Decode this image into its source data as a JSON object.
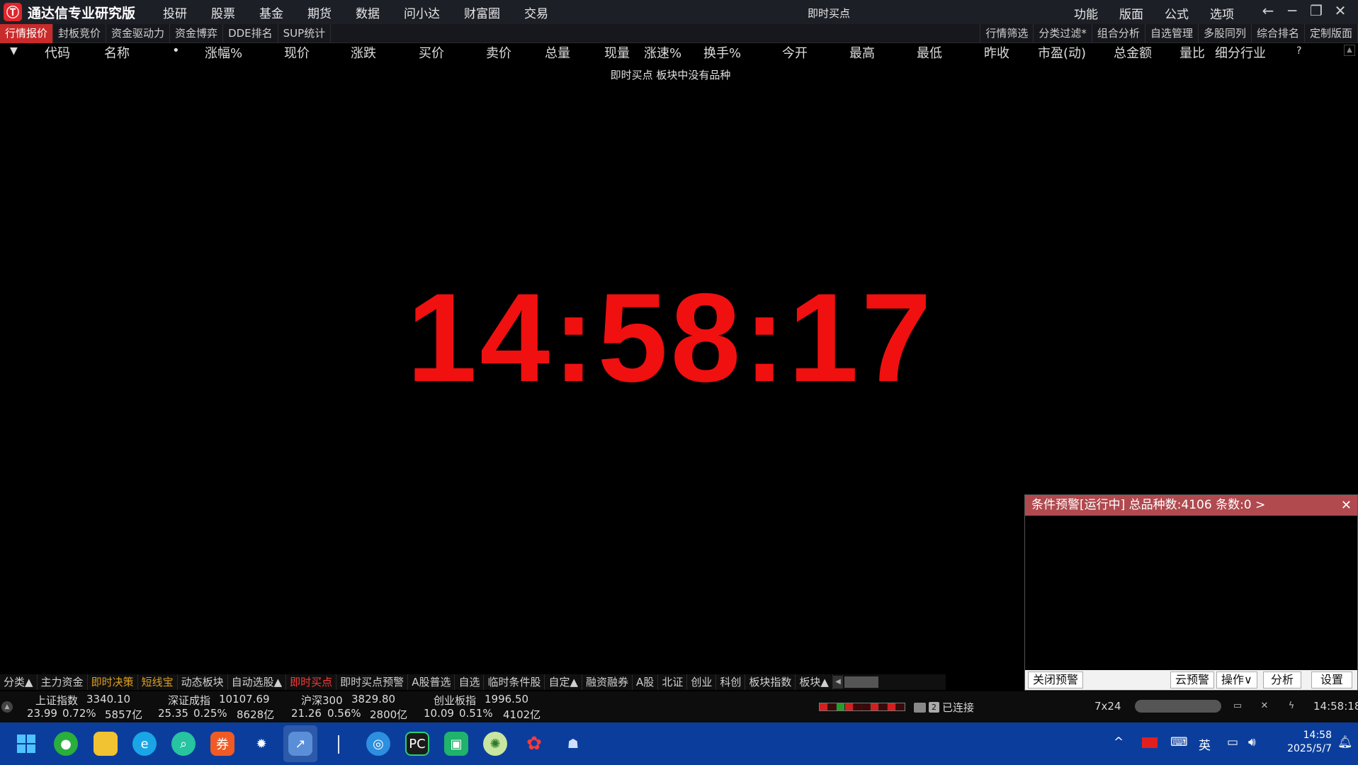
{
  "app": {
    "title": "通达信专业研究版",
    "logo_glyph": "Ⓣ",
    "menu": [
      "投研",
      "股票",
      "基金",
      "期货",
      "数据",
      "问小达",
      "财富圈",
      "交易"
    ],
    "window_title": "即时买点",
    "right_menu": [
      "功能",
      "版面",
      "公式",
      "选项"
    ],
    "controls": {
      "back": "←",
      "minimize": "─",
      "restore": "❐",
      "close": "✕"
    }
  },
  "tabs_left": [
    "行情报价",
    "封板竞价",
    "资金驱动力",
    "资金博弈",
    "DDE排名",
    "SUP统计"
  ],
  "tabs_right": [
    "行情筛选",
    "分类过滤*",
    "组合分析",
    "自选管理",
    "多股同列",
    "综合排名",
    "定制版面"
  ],
  "columns": [
    "▼",
    "代码",
    "名称",
    "•",
    "涨幅%",
    "现价",
    "涨跌",
    "买价",
    "卖价",
    "总量",
    "现量",
    "涨速%",
    "换手%",
    "今开",
    "最高",
    "最低",
    "昨收",
    "市盈(动)",
    "总金额",
    "量比",
    "细分行业",
    "?"
  ],
  "empty_message": "即时买点 板块中没有品种",
  "clock": "14:58:17",
  "alert": {
    "header": "条件预警[运行中] 总品种数:4106 条数:0  >",
    "close": "✕",
    "buttons": {
      "close_alert": "关闭预警",
      "cloud": "云预警",
      "operate": "操作∨",
      "analyze": "分析",
      "settings": "设置"
    }
  },
  "category_tabs": [
    "分类▲",
    "主力资金",
    "即时决策",
    "短线宝",
    "动态板块",
    "自动选股▲",
    "即时买点",
    "即时买点预警",
    "A股普选",
    "自选",
    "临时条件股",
    "自定▲",
    "融资融券",
    "A股",
    "北证",
    "创业",
    "科创",
    "板块指数",
    "板块▲"
  ],
  "indices": [
    {
      "name": "上证指数",
      "value": "3340.10",
      "change": "23.99",
      "pct": "0.72%",
      "amount": "5857亿"
    },
    {
      "name": "深证成指",
      "value": "10107.69",
      "change": "25.35",
      "pct": "0.25%",
      "amount": "8628亿"
    },
    {
      "name": "沪深300",
      "value": "3829.80",
      "change": "21.26",
      "pct": "0.56%",
      "amount": "2800亿"
    },
    {
      "name": "创业板指",
      "value": "1996.50",
      "change": "10.09",
      "pct": "0.51%",
      "amount": "4102亿"
    }
  ],
  "status": {
    "connection": "已连接",
    "badge": "2",
    "mode": "7x24",
    "time": "14:58:18"
  },
  "taskbar": {
    "clock_time": "14:58",
    "clock_date": "2025/5/7",
    "ime": "英",
    "icons": [
      "windows-start-icon",
      "wechat-icon",
      "file-explorer-icon",
      "edge-icon",
      "search-app-icon",
      "securities-app-icon",
      "settings-app-icon",
      "tdx-app-icon",
      "browser-app-icon",
      "pycharm-icon",
      "app-green-icon",
      "app-ring-icon",
      "app-flower-icon",
      "app-hat-icon"
    ]
  },
  "colors": {
    "accent_red": "#f01010",
    "header_bg": "#1d1f27",
    "alert_header": "#b04a4f",
    "taskbar": "#0b3e9c"
  }
}
